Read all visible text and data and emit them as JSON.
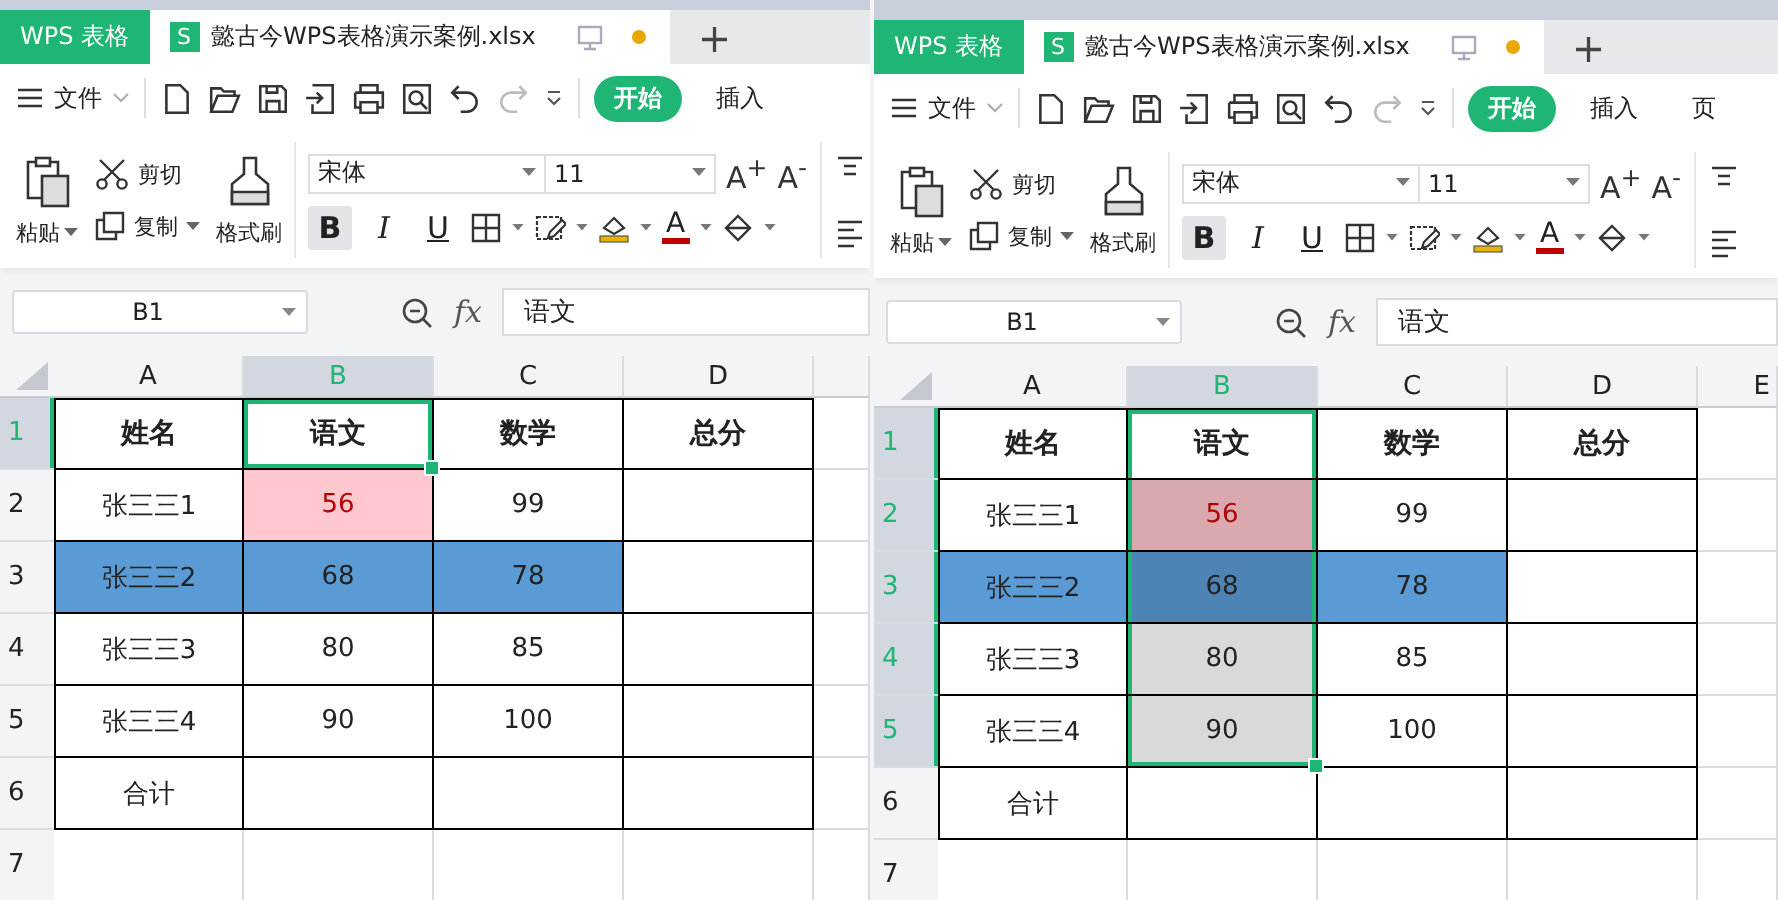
{
  "windows": [
    {
      "app_tab": "WPS 表格",
      "doc_tab": {
        "badge": "S",
        "title": "懿古今WPS表格演示案例.xlsx",
        "modified": true
      },
      "new_tab": "+",
      "file_menu": "文件",
      "ribbon_tabs": [
        {
          "label": "开始",
          "selected": true
        },
        {
          "label": "插入",
          "selected": false
        }
      ],
      "clipboard": {
        "paste": "粘贴",
        "cut": "剪切",
        "copy": "复制",
        "format_painter": "格式刷"
      },
      "font": {
        "name": "宋体",
        "size": "11",
        "grow": "A$^{+}$",
        "shrink": "A$^{-}$",
        "styles": [
          {
            "label": "B",
            "selected": true
          },
          {
            "label": "I",
            "selected": false
          },
          {
            "label": "U",
            "selected": false
          }
        ],
        "font_color": "A"
      },
      "name_box": "B1",
      "fx": "fx",
      "formula": "语文",
      "columns": [
        {
          "label": "A"
        },
        {
          "label": "B"
        },
        {
          "label": "C"
        },
        {
          "label": "D"
        }
      ],
      "rows": [
        {
          "header": "1",
          "bordered": true,
          "cells": [
            {
              "text": "姓名",
              "kind": "heading",
              "selected": false
            },
            {
              "text": "语文",
              "kind": "heading",
              "selected": true
            },
            {
              "text": "数学",
              "kind": "heading",
              "selected": false
            },
            {
              "text": "总分",
              "kind": "heading",
              "selected": false
            }
          ]
        },
        {
          "header": "2",
          "bordered": true,
          "cells": [
            {
              "text": "张三三1",
              "kind": "plain",
              "selected": false
            },
            {
              "text": "56",
              "kind": "alert",
              "selected": false
            },
            {
              "text": "99",
              "kind": "plain",
              "selected": false
            },
            {
              "kind": "plain",
              "selected": false
            }
          ]
        },
        {
          "header": "3",
          "bordered": true,
          "cells": [
            {
              "text": "张三三2",
              "kind": "highlight",
              "selected": false
            },
            {
              "text": "68",
              "kind": "highlight",
              "selected": false
            },
            {
              "text": "78",
              "kind": "highlight",
              "selected": false
            },
            {
              "kind": "plain",
              "selected": false
            }
          ]
        },
        {
          "header": "4",
          "bordered": true,
          "cells": [
            {
              "text": "张三三3",
              "kind": "plain",
              "selected": false
            },
            {
              "text": "80",
              "kind": "plain",
              "selected": false
            },
            {
              "text": "85",
              "kind": "plain",
              "selected": false
            },
            {
              "kind": "plain",
              "selected": false
            }
          ]
        },
        {
          "header": "5",
          "bordered": true,
          "cells": [
            {
              "text": "张三三4",
              "kind": "plain",
              "selected": false
            },
            {
              "text": "90",
              "kind": "plain",
              "selected": false
            },
            {
              "text": "100",
              "kind": "plain",
              "selected": false
            },
            {
              "kind": "plain",
              "selected": false
            }
          ]
        },
        {
          "header": "6",
          "bordered": true,
          "cells": [
            {
              "text": "合计",
              "kind": "plain",
              "selected": false
            },
            {
              "kind": "plain",
              "selected": false
            },
            {
              "kind": "plain",
              "selected": false
            },
            {
              "kind": "plain",
              "selected": false
            }
          ]
        },
        {
          "header": "7",
          "bordered": false,
          "cells": []
        }
      ]
    },
    {
      "app_tab": "WPS 表格",
      "doc_tab": {
        "badge": "S",
        "title": "懿古今WPS表格演示案例.xlsx",
        "modified": true
      },
      "new_tab": "+",
      "file_menu": "文件",
      "ribbon_tabs": [
        {
          "label": "开始",
          "selected": true
        },
        {
          "label": "插入",
          "selected": false
        },
        {
          "label": "页",
          "selected": false
        }
      ],
      "clipboard": {
        "paste": "粘贴",
        "cut": "剪切",
        "copy": "复制",
        "format_painter": "格式刷"
      },
      "font": {
        "name": "宋体",
        "size": "11",
        "grow": "A$^{+}$",
        "shrink": "A$^{-}$",
        "styles": [
          {
            "label": "B",
            "selected": true
          },
          {
            "label": "I",
            "selected": false
          },
          {
            "label": "U",
            "selected": false
          }
        ],
        "font_color": "A"
      },
      "name_box": "B1",
      "fx": "fx",
      "formula": "语文",
      "columns": [
        {
          "label": "A"
        },
        {
          "label": "B"
        },
        {
          "label": "C"
        },
        {
          "label": "D"
        },
        {
          "label": "E"
        }
      ],
      "rows": [
        {
          "header": "1",
          "bordered": true,
          "cells": [
            {
              "text": "姓名",
              "kind": "heading",
              "selected": false
            },
            {
              "text": "语文",
              "kind": "heading",
              "selected": true
            },
            {
              "text": "数学",
              "kind": "heading",
              "selected": false
            },
            {
              "text": "总分",
              "kind": "heading",
              "selected": false
            }
          ]
        },
        {
          "header": "2",
          "bordered": true,
          "cells": [
            {
              "text": "张三三1",
              "kind": "plain",
              "selected": false
            },
            {
              "text": "56",
              "kind": "alert",
              "selected": true
            },
            {
              "text": "99",
              "kind": "plain",
              "selected": false
            },
            {
              "kind": "plain",
              "selected": false
            }
          ]
        },
        {
          "header": "3",
          "bordered": true,
          "cells": [
            {
              "text": "张三三2",
              "kind": "highlight",
              "selected": false
            },
            {
              "text": "68",
              "kind": "highlight",
              "selected": true
            },
            {
              "text": "78",
              "kind": "highlight",
              "selected": false
            },
            {
              "kind": "plain",
              "selected": false
            }
          ]
        },
        {
          "header": "4",
          "bordered": true,
          "cells": [
            {
              "text": "张三三3",
              "kind": "plain",
              "selected": false
            },
            {
              "text": "80",
              "kind": "plain",
              "selected": true
            },
            {
              "text": "85",
              "kind": "plain",
              "selected": false
            },
            {
              "kind": "plain",
              "selected": false
            }
          ]
        },
        {
          "header": "5",
          "bordered": true,
          "cells": [
            {
              "text": "张三三4",
              "kind": "plain",
              "selected": false
            },
            {
              "text": "90",
              "kind": "plain",
              "selected": true
            },
            {
              "text": "100",
              "kind": "plain",
              "selected": false
            },
            {
              "kind": "plain",
              "selected": false
            }
          ]
        },
        {
          "header": "6",
          "bordered": true,
          "cells": [
            {
              "text": "合计",
              "kind": "plain",
              "selected": false
            },
            {
              "kind": "plain",
              "selected": false
            },
            {
              "kind": "plain",
              "selected": false
            },
            {
              "kind": "plain",
              "selected": false
            }
          ]
        },
        {
          "header": "7",
          "bordered": false,
          "cells": []
        }
      ]
    }
  ]
}
